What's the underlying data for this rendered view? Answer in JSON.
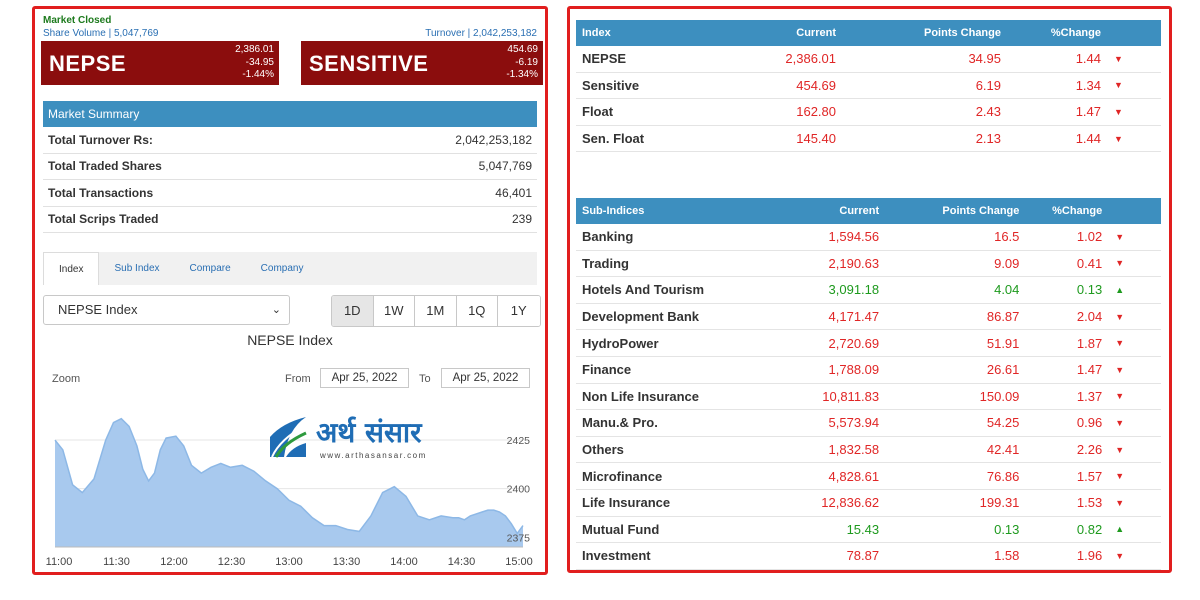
{
  "market": {
    "status": "Market Closed",
    "share_volume": "Share Volume | 5,047,769",
    "turnover": "Turnover | 2,042,253,182"
  },
  "nepse_box": {
    "name": "NEPSE",
    "value": "2,386.01",
    "change": "-34.95",
    "pct": "-1.44%"
  },
  "sensitive_box": {
    "name": "SENSITIVE",
    "value": "454.69",
    "change": "-6.19",
    "pct": "-1.34%"
  },
  "summary": {
    "title": "Market Summary",
    "rows": [
      {
        "label": "Total Turnover Rs:",
        "value": "2,042,253,182"
      },
      {
        "label": "Total Traded Shares",
        "value": "5,047,769"
      },
      {
        "label": "Total Transactions",
        "value": "46,401"
      },
      {
        "label": "Total Scrips Traded",
        "value": "239"
      }
    ]
  },
  "tabs": [
    "Index",
    "Sub Index",
    "Compare",
    "Company"
  ],
  "index_select": "NEPSE Index",
  "ranges": [
    "1D",
    "1W",
    "1M",
    "1Q",
    "1Y"
  ],
  "chart_controls": {
    "zoom": "Zoom",
    "from": "From",
    "to": "To",
    "from_date": "Apr 25, 2022",
    "to_date": "Apr 25, 2022"
  },
  "logo": {
    "brand": "अर्थ संसार",
    "url": "www.arthasansar.com"
  },
  "colors": {
    "accent": "#3d8fbf",
    "brand_red": "#8b0d0d",
    "down": "#e02626",
    "up": "#1e9a1e",
    "border": "#e11e1e"
  },
  "chart_data": {
    "type": "area",
    "title": "NEPSE Index",
    "x_ticks": [
      "11:00",
      "11:30",
      "12:00",
      "12:30",
      "13:00",
      "13:30",
      "14:00",
      "14:30",
      "15:00"
    ],
    "y_ticks": [
      2375,
      2400,
      2425
    ],
    "ylim": [
      2370,
      2442
    ],
    "x": [
      0,
      4,
      9,
      14,
      20,
      26,
      30,
      34,
      38,
      42,
      45,
      48,
      51,
      54,
      57,
      62,
      66,
      70,
      75,
      80,
      85,
      90,
      96,
      102,
      108,
      114,
      120,
      126,
      132,
      138,
      144,
      150,
      156,
      162,
      168,
      174,
      180,
      186,
      192,
      198,
      204,
      207,
      210,
      213,
      216,
      219,
      222,
      225,
      228,
      231,
      234,
      237,
      240
    ],
    "y": [
      2425,
      2420,
      2402,
      2398,
      2405,
      2425,
      2434,
      2436,
      2432,
      2422,
      2410,
      2404,
      2408,
      2420,
      2426,
      2427,
      2422,
      2412,
      2408,
      2411,
      2413,
      2411,
      2412,
      2409,
      2404,
      2400,
      2394,
      2391,
      2385,
      2381,
      2381,
      2379,
      2378,
      2386,
      2398,
      2401,
      2396,
      2386,
      2384,
      2386,
      2385,
      2385,
      2384,
      2386,
      2387,
      2388,
      2389,
      2389,
      2388,
      2386,
      2382,
      2377,
      2381
    ]
  },
  "index_table": {
    "headers": [
      "Index",
      "Current",
      "Points Change",
      "%Change"
    ],
    "rows": [
      {
        "name": "NEPSE",
        "current": "2,386.01",
        "points": "34.95",
        "pct": "1.44",
        "dir": "down"
      },
      {
        "name": "Sensitive",
        "current": "454.69",
        "points": "6.19",
        "pct": "1.34",
        "dir": "down"
      },
      {
        "name": "Float",
        "current": "162.80",
        "points": "2.43",
        "pct": "1.47",
        "dir": "down"
      },
      {
        "name": "Sen. Float",
        "current": "145.40",
        "points": "2.13",
        "pct": "1.44",
        "dir": "down"
      }
    ]
  },
  "sub_table": {
    "headers": [
      "Sub-Indices",
      "Current",
      "Points Change",
      "%Change"
    ],
    "rows": [
      {
        "name": "Banking",
        "current": "1,594.56",
        "points": "16.5",
        "pct": "1.02",
        "dir": "down"
      },
      {
        "name": "Trading",
        "current": "2,190.63",
        "points": "9.09",
        "pct": "0.41",
        "dir": "down"
      },
      {
        "name": "Hotels And Tourism",
        "current": "3,091.18",
        "points": "4.04",
        "pct": "0.13",
        "dir": "up"
      },
      {
        "name": "Development Bank",
        "current": "4,171.47",
        "points": "86.87",
        "pct": "2.04",
        "dir": "down"
      },
      {
        "name": "HydroPower",
        "current": "2,720.69",
        "points": "51.91",
        "pct": "1.87",
        "dir": "down"
      },
      {
        "name": "Finance",
        "current": "1,788.09",
        "points": "26.61",
        "pct": "1.47",
        "dir": "down"
      },
      {
        "name": "Non Life Insurance",
        "current": "10,811.83",
        "points": "150.09",
        "pct": "1.37",
        "dir": "down"
      },
      {
        "name": "Manu.& Pro.",
        "current": "5,573.94",
        "points": "54.25",
        "pct": "0.96",
        "dir": "down"
      },
      {
        "name": "Others",
        "current": "1,832.58",
        "points": "42.41",
        "pct": "2.26",
        "dir": "down"
      },
      {
        "name": "Microfinance",
        "current": "4,828.61",
        "points": "76.86",
        "pct": "1.57",
        "dir": "down"
      },
      {
        "name": "Life Insurance",
        "current": "12,836.62",
        "points": "199.31",
        "pct": "1.53",
        "dir": "down"
      },
      {
        "name": "Mutual Fund",
        "current": "15.43",
        "points": "0.13",
        "pct": "0.82",
        "dir": "up"
      },
      {
        "name": "Investment",
        "current": "78.87",
        "points": "1.58",
        "pct": "1.96",
        "dir": "down"
      }
    ]
  }
}
